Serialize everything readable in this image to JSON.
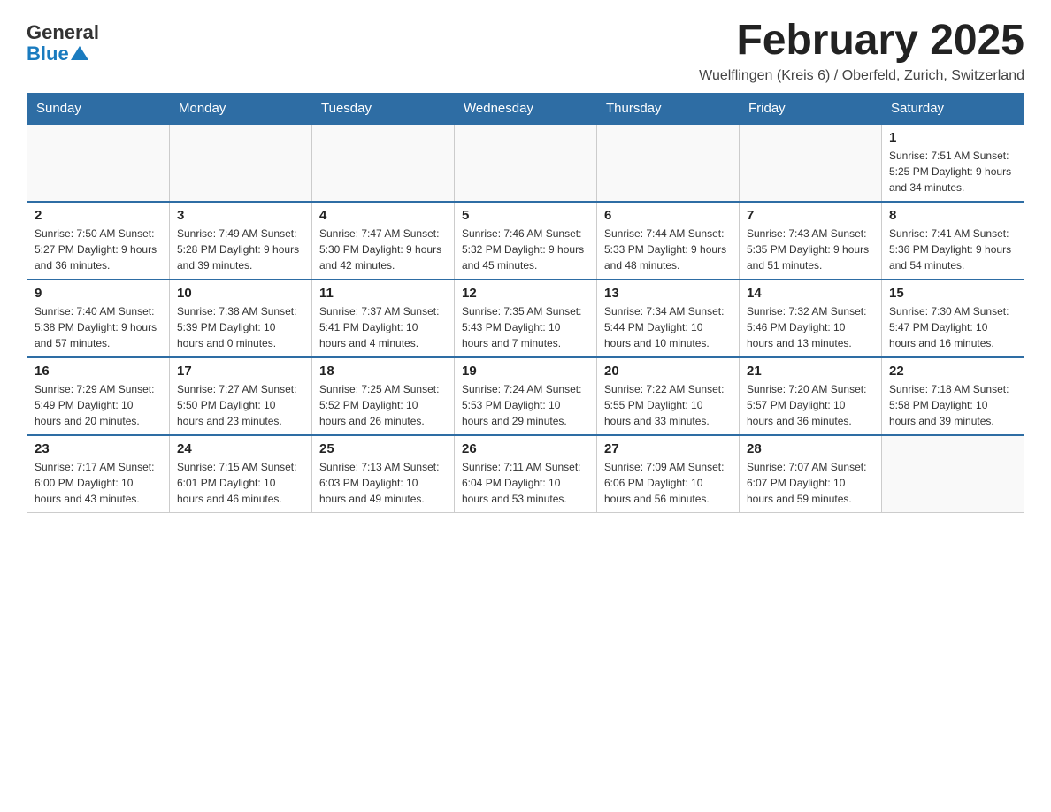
{
  "header": {
    "logo_general": "General",
    "logo_blue": "Blue",
    "month_title": "February 2025",
    "location": "Wuelflingen (Kreis 6) / Oberfeld, Zurich, Switzerland"
  },
  "days_of_week": [
    "Sunday",
    "Monday",
    "Tuesday",
    "Wednesday",
    "Thursday",
    "Friday",
    "Saturday"
  ],
  "weeks": [
    {
      "days": [
        {
          "number": "",
          "info": ""
        },
        {
          "number": "",
          "info": ""
        },
        {
          "number": "",
          "info": ""
        },
        {
          "number": "",
          "info": ""
        },
        {
          "number": "",
          "info": ""
        },
        {
          "number": "",
          "info": ""
        },
        {
          "number": "1",
          "info": "Sunrise: 7:51 AM\nSunset: 5:25 PM\nDaylight: 9 hours and 34 minutes."
        }
      ]
    },
    {
      "days": [
        {
          "number": "2",
          "info": "Sunrise: 7:50 AM\nSunset: 5:27 PM\nDaylight: 9 hours and 36 minutes."
        },
        {
          "number": "3",
          "info": "Sunrise: 7:49 AM\nSunset: 5:28 PM\nDaylight: 9 hours and 39 minutes."
        },
        {
          "number": "4",
          "info": "Sunrise: 7:47 AM\nSunset: 5:30 PM\nDaylight: 9 hours and 42 minutes."
        },
        {
          "number": "5",
          "info": "Sunrise: 7:46 AM\nSunset: 5:32 PM\nDaylight: 9 hours and 45 minutes."
        },
        {
          "number": "6",
          "info": "Sunrise: 7:44 AM\nSunset: 5:33 PM\nDaylight: 9 hours and 48 minutes."
        },
        {
          "number": "7",
          "info": "Sunrise: 7:43 AM\nSunset: 5:35 PM\nDaylight: 9 hours and 51 minutes."
        },
        {
          "number": "8",
          "info": "Sunrise: 7:41 AM\nSunset: 5:36 PM\nDaylight: 9 hours and 54 minutes."
        }
      ]
    },
    {
      "days": [
        {
          "number": "9",
          "info": "Sunrise: 7:40 AM\nSunset: 5:38 PM\nDaylight: 9 hours and 57 minutes."
        },
        {
          "number": "10",
          "info": "Sunrise: 7:38 AM\nSunset: 5:39 PM\nDaylight: 10 hours and 0 minutes."
        },
        {
          "number": "11",
          "info": "Sunrise: 7:37 AM\nSunset: 5:41 PM\nDaylight: 10 hours and 4 minutes."
        },
        {
          "number": "12",
          "info": "Sunrise: 7:35 AM\nSunset: 5:43 PM\nDaylight: 10 hours and 7 minutes."
        },
        {
          "number": "13",
          "info": "Sunrise: 7:34 AM\nSunset: 5:44 PM\nDaylight: 10 hours and 10 minutes."
        },
        {
          "number": "14",
          "info": "Sunrise: 7:32 AM\nSunset: 5:46 PM\nDaylight: 10 hours and 13 minutes."
        },
        {
          "number": "15",
          "info": "Sunrise: 7:30 AM\nSunset: 5:47 PM\nDaylight: 10 hours and 16 minutes."
        }
      ]
    },
    {
      "days": [
        {
          "number": "16",
          "info": "Sunrise: 7:29 AM\nSunset: 5:49 PM\nDaylight: 10 hours and 20 minutes."
        },
        {
          "number": "17",
          "info": "Sunrise: 7:27 AM\nSunset: 5:50 PM\nDaylight: 10 hours and 23 minutes."
        },
        {
          "number": "18",
          "info": "Sunrise: 7:25 AM\nSunset: 5:52 PM\nDaylight: 10 hours and 26 minutes."
        },
        {
          "number": "19",
          "info": "Sunrise: 7:24 AM\nSunset: 5:53 PM\nDaylight: 10 hours and 29 minutes."
        },
        {
          "number": "20",
          "info": "Sunrise: 7:22 AM\nSunset: 5:55 PM\nDaylight: 10 hours and 33 minutes."
        },
        {
          "number": "21",
          "info": "Sunrise: 7:20 AM\nSunset: 5:57 PM\nDaylight: 10 hours and 36 minutes."
        },
        {
          "number": "22",
          "info": "Sunrise: 7:18 AM\nSunset: 5:58 PM\nDaylight: 10 hours and 39 minutes."
        }
      ]
    },
    {
      "days": [
        {
          "number": "23",
          "info": "Sunrise: 7:17 AM\nSunset: 6:00 PM\nDaylight: 10 hours and 43 minutes."
        },
        {
          "number": "24",
          "info": "Sunrise: 7:15 AM\nSunset: 6:01 PM\nDaylight: 10 hours and 46 minutes."
        },
        {
          "number": "25",
          "info": "Sunrise: 7:13 AM\nSunset: 6:03 PM\nDaylight: 10 hours and 49 minutes."
        },
        {
          "number": "26",
          "info": "Sunrise: 7:11 AM\nSunset: 6:04 PM\nDaylight: 10 hours and 53 minutes."
        },
        {
          "number": "27",
          "info": "Sunrise: 7:09 AM\nSunset: 6:06 PM\nDaylight: 10 hours and 56 minutes."
        },
        {
          "number": "28",
          "info": "Sunrise: 7:07 AM\nSunset: 6:07 PM\nDaylight: 10 hours and 59 minutes."
        },
        {
          "number": "",
          "info": ""
        }
      ]
    }
  ]
}
